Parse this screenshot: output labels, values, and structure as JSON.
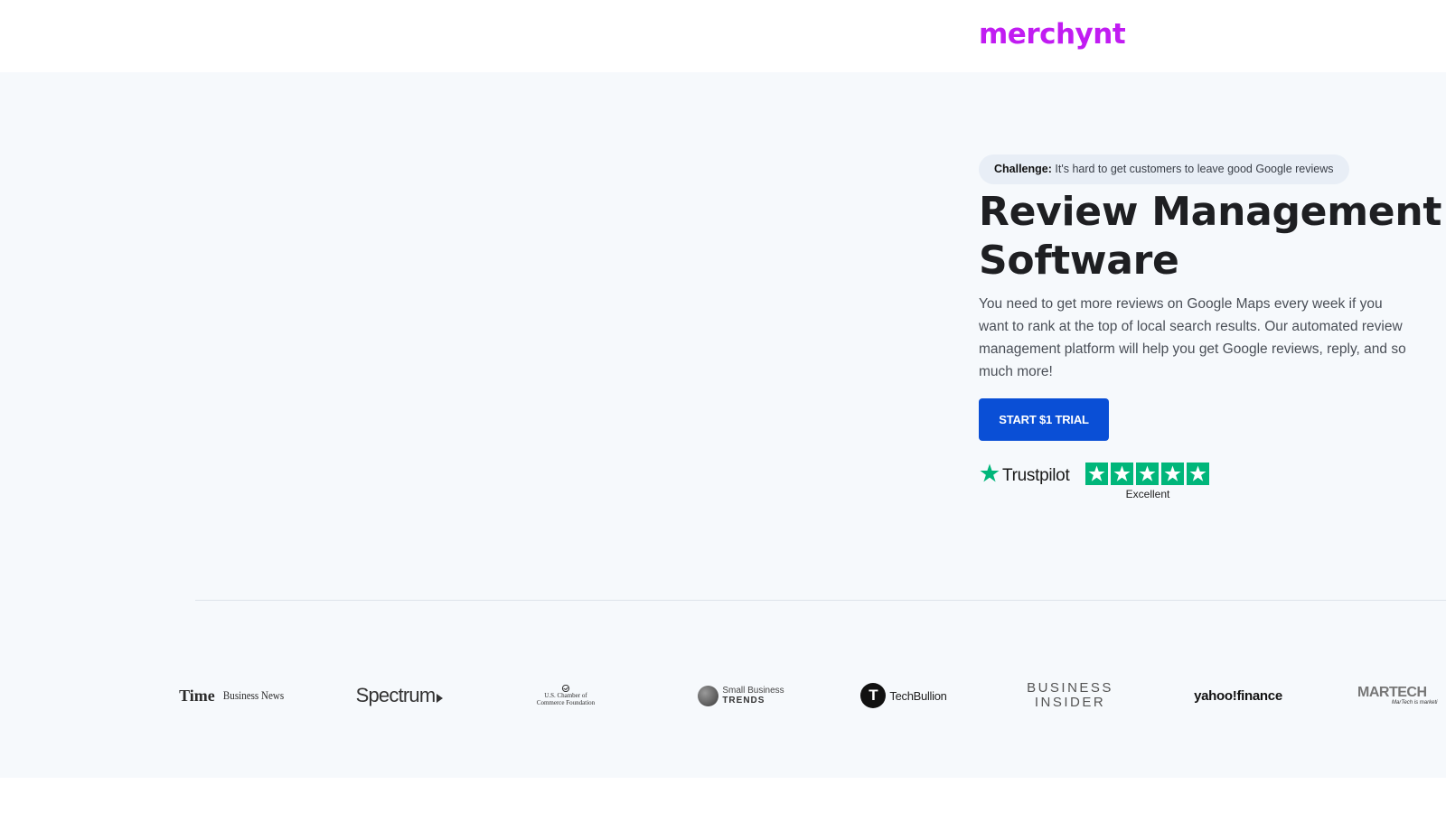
{
  "header": {
    "logo": "merchynt",
    "logo_color": "#c11cf2"
  },
  "hero": {
    "challenge_label": "Challenge:",
    "challenge_text": "It's hard to get customers to leave good Google reviews",
    "title_line1": "Review Management",
    "title_line2": "Software",
    "description": "You need to get more reviews on Google Maps every week if you want to rank at the top of local search results. Our automated review management platform will help you get Google reviews, reply, and so much more!",
    "cta_label": "START $1 TRIAL"
  },
  "trustpilot": {
    "name": "Trustpilot",
    "rating_text": "Excellent",
    "stars": 5,
    "color": "#00b67a"
  },
  "press": {
    "time_business_news": {
      "line1": "Time",
      "line2": "Business News"
    },
    "spectrum": "Spectrum",
    "us_chamber": {
      "line1": "U.S. Chamber of",
      "line2": "Commerce Foundation"
    },
    "small_business_trends": {
      "line1": "Small Business",
      "line2": "TRENDS"
    },
    "techbullion": "TechBullion",
    "business_insider": {
      "line1": "BUSINESS",
      "line2": "INSIDER"
    },
    "yahoo_finance": "yahoo!finance",
    "martech": {
      "line1": "MARTECH",
      "line2": "MarTech is marketi"
    }
  },
  "colors": {
    "accent": "#0a4fd6",
    "hero_bg": "#f6f9fc"
  }
}
